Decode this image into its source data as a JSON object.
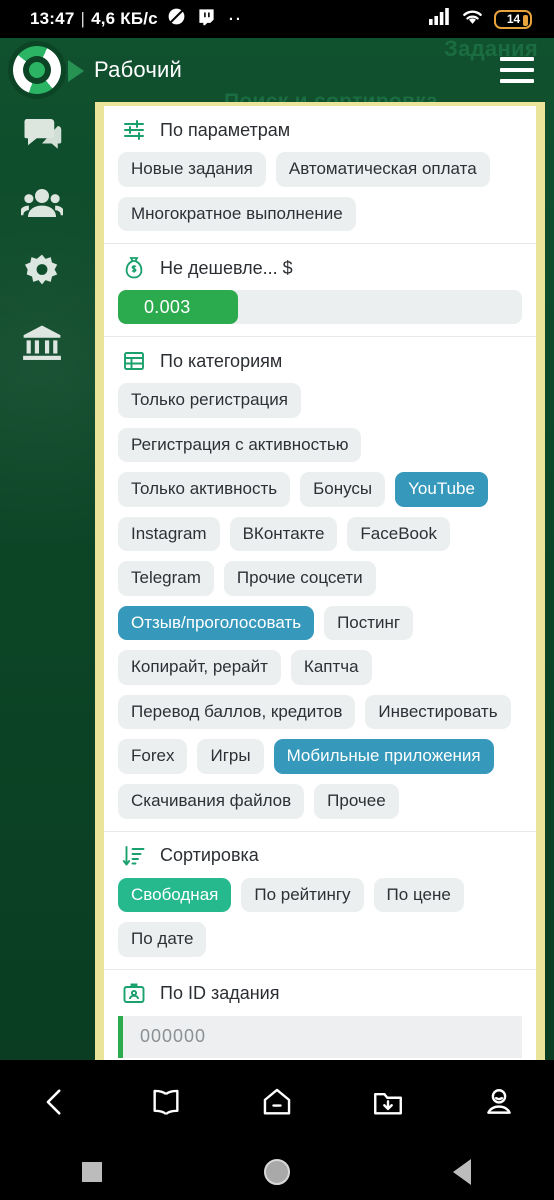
{
  "status_bar": {
    "time": "13:47",
    "separator": "|",
    "network_speed": "4,6 КБ/c",
    "icons": [
      "no-sound-icon",
      "twitch-icon",
      "more-dots-icon",
      "signal-icon",
      "wifi-icon"
    ],
    "battery_percent": "14"
  },
  "app_header": {
    "title": "Рабочий",
    "logo_name": "app-logo",
    "menu_name": "hamburger-menu"
  },
  "background_text": {
    "tasks": "Задания",
    "search_and_sort": "Поиск и сортировка"
  },
  "sidebar": {
    "items": [
      {
        "icon": "chat-icon",
        "name": "sidebar-item-chat"
      },
      {
        "icon": "people-icon",
        "name": "sidebar-item-people"
      },
      {
        "icon": "gear-icon",
        "name": "sidebar-item-settings"
      },
      {
        "icon": "bank-icon",
        "name": "sidebar-item-bank"
      }
    ]
  },
  "filters": {
    "parameters": {
      "icon": "sliders-icon",
      "title": "По параметрам",
      "chips": [
        {
          "label": "Новые задания",
          "selected": false
        },
        {
          "label": "Автоматическая оплата",
          "selected": false
        },
        {
          "label": "Многократное выполнение",
          "selected": false
        }
      ]
    },
    "price": {
      "icon": "money-bag-icon",
      "title": "Не дешевле... $",
      "value": "0.003"
    },
    "categories": {
      "icon": "table-grid-icon",
      "title": "По категориям",
      "chips": [
        {
          "label": "Только регистрация",
          "selected": false
        },
        {
          "label": "Регистрация с активностью",
          "selected": false
        },
        {
          "label": "Только активность",
          "selected": false
        },
        {
          "label": "Бонусы",
          "selected": false
        },
        {
          "label": "YouTube",
          "selected": true
        },
        {
          "label": "Instagram",
          "selected": false
        },
        {
          "label": "ВКонтакте",
          "selected": false
        },
        {
          "label": "FaceBook",
          "selected": false
        },
        {
          "label": "Telegram",
          "selected": false
        },
        {
          "label": "Прочие соцсети",
          "selected": false
        },
        {
          "label": "Отзыв/проголосовать",
          "selected": true
        },
        {
          "label": "Постинг",
          "selected": false
        },
        {
          "label": "Копирайт, рерайт",
          "selected": false
        },
        {
          "label": "Каптча",
          "selected": false
        },
        {
          "label": "Перевод баллов, кредитов",
          "selected": false
        },
        {
          "label": "Инвестировать",
          "selected": false
        },
        {
          "label": "Forex",
          "selected": false
        },
        {
          "label": "Игры",
          "selected": false
        },
        {
          "label": "Мобильные приложения",
          "selected": true
        },
        {
          "label": "Скачивания файлов",
          "selected": false
        },
        {
          "label": "Прочее",
          "selected": false
        }
      ]
    },
    "sorting": {
      "icon": "sort-descending-icon",
      "title": "Сортировка",
      "chips": [
        {
          "label": "Свободная",
          "selected": true
        },
        {
          "label": "По рейтингу",
          "selected": false
        },
        {
          "label": "По цене",
          "selected": false
        },
        {
          "label": "По дате",
          "selected": false
        }
      ]
    },
    "task_id": {
      "icon": "id-card-icon",
      "title": "По ID задания",
      "placeholder": "000000"
    }
  },
  "browser_nav": {
    "items": [
      {
        "icon": "back-chevron-icon",
        "name": "browser-back-button"
      },
      {
        "icon": "book-icon",
        "name": "browser-bookmarks-button"
      },
      {
        "icon": "home-icon",
        "name": "browser-home-button"
      },
      {
        "icon": "download-folder-icon",
        "name": "browser-downloads-button"
      },
      {
        "icon": "profile-icon",
        "name": "browser-profile-button"
      }
    ]
  },
  "system_nav": {
    "items": [
      {
        "icon": "recents-square-icon",
        "name": "system-recents-button"
      },
      {
        "icon": "home-circle-icon",
        "name": "system-home-button"
      },
      {
        "icon": "back-triangle-icon",
        "name": "system-back-button"
      }
    ]
  },
  "colors": {
    "brand_dark_green": "#0e4d2b",
    "accent_green": "#2cab4e",
    "selected_blue": "#3699bc",
    "selected_teal": "#27b98e",
    "panel_border_yellow": "#e9e49a",
    "chip_gray": "#eceff0",
    "battery_orange": "#e8a33d"
  }
}
